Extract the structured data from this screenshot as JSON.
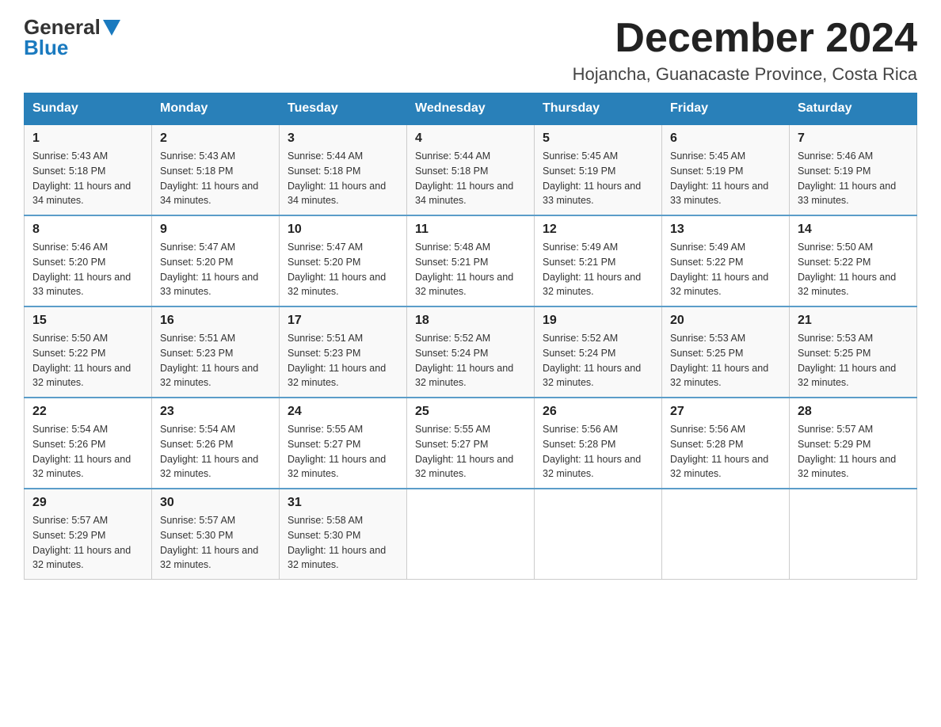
{
  "header": {
    "logo": {
      "line1": "General",
      "line2": "Blue"
    },
    "main_title": "December 2024",
    "subtitle": "Hojancha, Guanacaste Province, Costa Rica"
  },
  "weekdays": [
    "Sunday",
    "Monday",
    "Tuesday",
    "Wednesday",
    "Thursday",
    "Friday",
    "Saturday"
  ],
  "weeks": [
    [
      {
        "day": "1",
        "sunrise": "Sunrise: 5:43 AM",
        "sunset": "Sunset: 5:18 PM",
        "daylight": "Daylight: 11 hours and 34 minutes."
      },
      {
        "day": "2",
        "sunrise": "Sunrise: 5:43 AM",
        "sunset": "Sunset: 5:18 PM",
        "daylight": "Daylight: 11 hours and 34 minutes."
      },
      {
        "day": "3",
        "sunrise": "Sunrise: 5:44 AM",
        "sunset": "Sunset: 5:18 PM",
        "daylight": "Daylight: 11 hours and 34 minutes."
      },
      {
        "day": "4",
        "sunrise": "Sunrise: 5:44 AM",
        "sunset": "Sunset: 5:18 PM",
        "daylight": "Daylight: 11 hours and 34 minutes."
      },
      {
        "day": "5",
        "sunrise": "Sunrise: 5:45 AM",
        "sunset": "Sunset: 5:19 PM",
        "daylight": "Daylight: 11 hours and 33 minutes."
      },
      {
        "day": "6",
        "sunrise": "Sunrise: 5:45 AM",
        "sunset": "Sunset: 5:19 PM",
        "daylight": "Daylight: 11 hours and 33 minutes."
      },
      {
        "day": "7",
        "sunrise": "Sunrise: 5:46 AM",
        "sunset": "Sunset: 5:19 PM",
        "daylight": "Daylight: 11 hours and 33 minutes."
      }
    ],
    [
      {
        "day": "8",
        "sunrise": "Sunrise: 5:46 AM",
        "sunset": "Sunset: 5:20 PM",
        "daylight": "Daylight: 11 hours and 33 minutes."
      },
      {
        "day": "9",
        "sunrise": "Sunrise: 5:47 AM",
        "sunset": "Sunset: 5:20 PM",
        "daylight": "Daylight: 11 hours and 33 minutes."
      },
      {
        "day": "10",
        "sunrise": "Sunrise: 5:47 AM",
        "sunset": "Sunset: 5:20 PM",
        "daylight": "Daylight: 11 hours and 32 minutes."
      },
      {
        "day": "11",
        "sunrise": "Sunrise: 5:48 AM",
        "sunset": "Sunset: 5:21 PM",
        "daylight": "Daylight: 11 hours and 32 minutes."
      },
      {
        "day": "12",
        "sunrise": "Sunrise: 5:49 AM",
        "sunset": "Sunset: 5:21 PM",
        "daylight": "Daylight: 11 hours and 32 minutes."
      },
      {
        "day": "13",
        "sunrise": "Sunrise: 5:49 AM",
        "sunset": "Sunset: 5:22 PM",
        "daylight": "Daylight: 11 hours and 32 minutes."
      },
      {
        "day": "14",
        "sunrise": "Sunrise: 5:50 AM",
        "sunset": "Sunset: 5:22 PM",
        "daylight": "Daylight: 11 hours and 32 minutes."
      }
    ],
    [
      {
        "day": "15",
        "sunrise": "Sunrise: 5:50 AM",
        "sunset": "Sunset: 5:22 PM",
        "daylight": "Daylight: 11 hours and 32 minutes."
      },
      {
        "day": "16",
        "sunrise": "Sunrise: 5:51 AM",
        "sunset": "Sunset: 5:23 PM",
        "daylight": "Daylight: 11 hours and 32 minutes."
      },
      {
        "day": "17",
        "sunrise": "Sunrise: 5:51 AM",
        "sunset": "Sunset: 5:23 PM",
        "daylight": "Daylight: 11 hours and 32 minutes."
      },
      {
        "day": "18",
        "sunrise": "Sunrise: 5:52 AM",
        "sunset": "Sunset: 5:24 PM",
        "daylight": "Daylight: 11 hours and 32 minutes."
      },
      {
        "day": "19",
        "sunrise": "Sunrise: 5:52 AM",
        "sunset": "Sunset: 5:24 PM",
        "daylight": "Daylight: 11 hours and 32 minutes."
      },
      {
        "day": "20",
        "sunrise": "Sunrise: 5:53 AM",
        "sunset": "Sunset: 5:25 PM",
        "daylight": "Daylight: 11 hours and 32 minutes."
      },
      {
        "day": "21",
        "sunrise": "Sunrise: 5:53 AM",
        "sunset": "Sunset: 5:25 PM",
        "daylight": "Daylight: 11 hours and 32 minutes."
      }
    ],
    [
      {
        "day": "22",
        "sunrise": "Sunrise: 5:54 AM",
        "sunset": "Sunset: 5:26 PM",
        "daylight": "Daylight: 11 hours and 32 minutes."
      },
      {
        "day": "23",
        "sunrise": "Sunrise: 5:54 AM",
        "sunset": "Sunset: 5:26 PM",
        "daylight": "Daylight: 11 hours and 32 minutes."
      },
      {
        "day": "24",
        "sunrise": "Sunrise: 5:55 AM",
        "sunset": "Sunset: 5:27 PM",
        "daylight": "Daylight: 11 hours and 32 minutes."
      },
      {
        "day": "25",
        "sunrise": "Sunrise: 5:55 AM",
        "sunset": "Sunset: 5:27 PM",
        "daylight": "Daylight: 11 hours and 32 minutes."
      },
      {
        "day": "26",
        "sunrise": "Sunrise: 5:56 AM",
        "sunset": "Sunset: 5:28 PM",
        "daylight": "Daylight: 11 hours and 32 minutes."
      },
      {
        "day": "27",
        "sunrise": "Sunrise: 5:56 AM",
        "sunset": "Sunset: 5:28 PM",
        "daylight": "Daylight: 11 hours and 32 minutes."
      },
      {
        "day": "28",
        "sunrise": "Sunrise: 5:57 AM",
        "sunset": "Sunset: 5:29 PM",
        "daylight": "Daylight: 11 hours and 32 minutes."
      }
    ],
    [
      {
        "day": "29",
        "sunrise": "Sunrise: 5:57 AM",
        "sunset": "Sunset: 5:29 PM",
        "daylight": "Daylight: 11 hours and 32 minutes."
      },
      {
        "day": "30",
        "sunrise": "Sunrise: 5:57 AM",
        "sunset": "Sunset: 5:30 PM",
        "daylight": "Daylight: 11 hours and 32 minutes."
      },
      {
        "day": "31",
        "sunrise": "Sunrise: 5:58 AM",
        "sunset": "Sunset: 5:30 PM",
        "daylight": "Daylight: 11 hours and 32 minutes."
      },
      null,
      null,
      null,
      null
    ]
  ]
}
